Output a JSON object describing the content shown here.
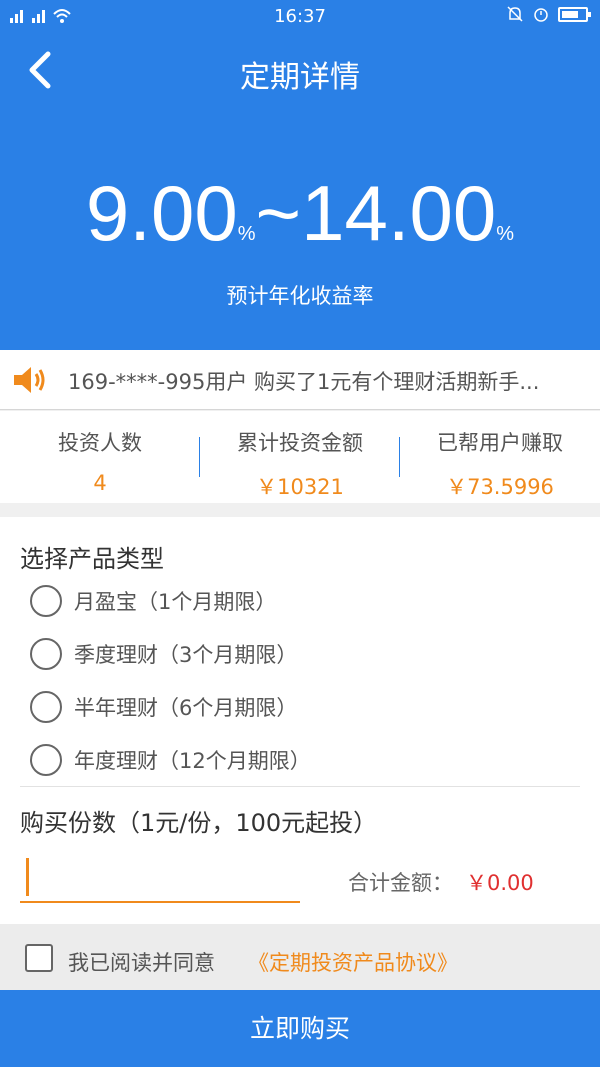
{
  "status_bar": {
    "signal_text": "2G 4G",
    "time": "16:37",
    "icons": [
      "signal-icon",
      "wifi-icon",
      "alarm-off-icon",
      "alarm-icon",
      "battery-icon"
    ]
  },
  "header": {
    "title": "定期详情",
    "rate_low": "9.00",
    "rate_sep": "~",
    "rate_high": "14.00",
    "percent": "%",
    "rate_label": "预计年化收益率",
    "background_color": "#2a80e6"
  },
  "notice": {
    "text": "169-****-995用户 购买了1元有个理财活期新手..."
  },
  "stats": [
    {
      "label": "投资人数",
      "value": "4"
    },
    {
      "label": "累计投资金额",
      "value": "￥10321"
    },
    {
      "label": "已帮用户赚取",
      "value": "￥73.5996"
    }
  ],
  "product_select": {
    "title": "选择产品类型",
    "options": [
      {
        "label": "月盈宝（1个月期限）"
      },
      {
        "label": "季度理财（3个月期限）"
      },
      {
        "label": "半年理财（6个月期限）"
      },
      {
        "label": "年度理财（12个月期限）"
      }
    ]
  },
  "quantity": {
    "title": "购买份数（1元/份，100元起投）",
    "value": "",
    "total_label": "合计金额：",
    "total_value": "￥0.00"
  },
  "agreement": {
    "text": "我已阅读并同意",
    "link": "《定期投资产品协议》"
  },
  "buy_button": {
    "label": "立即购买"
  },
  "colors": {
    "primary": "#2a80e6",
    "accent": "#f08a1c",
    "price": "#e03030"
  }
}
